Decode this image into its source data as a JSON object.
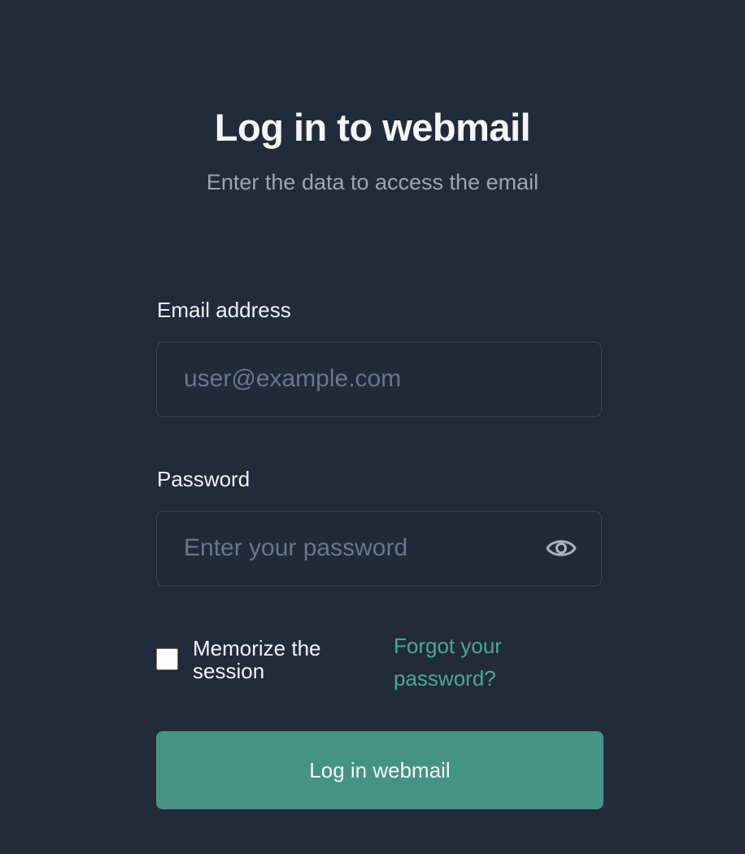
{
  "header": {
    "title": "Log in to webmail",
    "subtitle": "Enter the data to access the email"
  },
  "form": {
    "email": {
      "label": "Email address",
      "value": "",
      "placeholder": "user@example.com"
    },
    "password": {
      "label": "Password",
      "value": "",
      "placeholder": "Enter your password",
      "toggle_icon": "eye-icon"
    },
    "remember": {
      "label": "Memorize the session",
      "checked": false
    },
    "forgot_link": "Forgot your password?",
    "submit_label": "Log in webmail"
  },
  "colors": {
    "background": "#222b3b",
    "accent": "#449384",
    "link": "#4fa694",
    "input_border": "#3a4558"
  }
}
